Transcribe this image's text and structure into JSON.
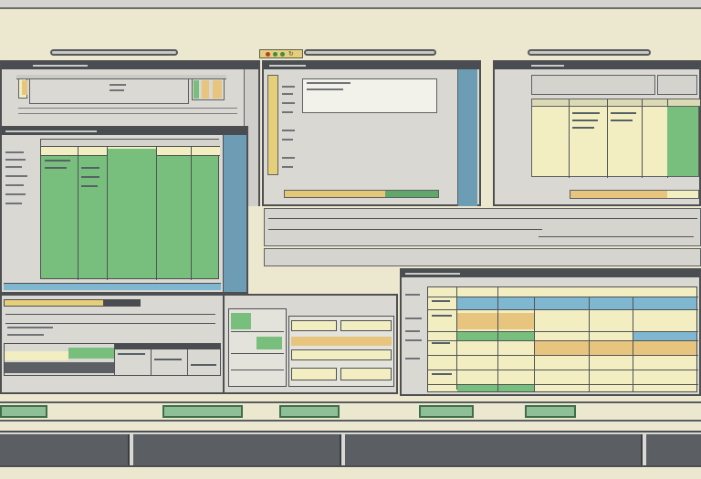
{
  "desktop": {
    "background": "#ece7cf",
    "accent_green": "#78bf7e",
    "accent_yellow": "#f2eec2",
    "accent_blue": "#7fb6d0",
    "accent_amber": "#e7c57e"
  },
  "windows": [
    {
      "id": "top-left",
      "title": ""
    },
    {
      "id": "top-middle",
      "title": ""
    },
    {
      "id": "top-right",
      "title": ""
    },
    {
      "id": "mid-left-spreadsheet",
      "title": ""
    },
    {
      "id": "bottom-left",
      "title": ""
    },
    {
      "id": "bottom-middle",
      "title": ""
    },
    {
      "id": "bottom-right-spreadsheet",
      "title": ""
    }
  ],
  "toolbar_icons": [
    "close-dot-icon",
    "minimize-dot-icon",
    "maximize-dot-icon",
    "refresh-icon"
  ],
  "taskbar": {
    "buttons": [
      {
        "label": ""
      },
      {
        "label": ""
      },
      {
        "label": ""
      },
      {
        "label": ""
      },
      {
        "label": ""
      }
    ]
  }
}
